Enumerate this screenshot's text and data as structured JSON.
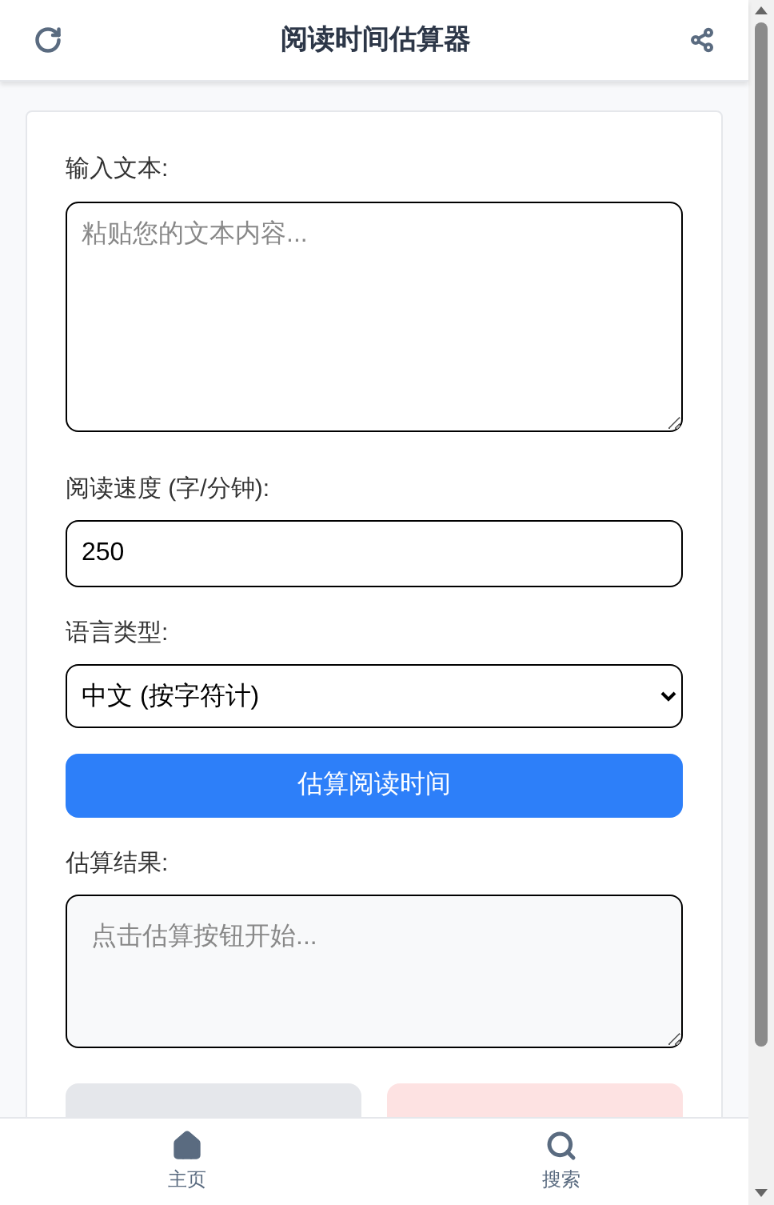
{
  "header": {
    "title": "阅读时间估算器"
  },
  "form": {
    "text_label": "输入文本:",
    "text_placeholder": "粘贴您的文本内容...",
    "speed_label": "阅读速度 (字/分钟):",
    "speed_value": "250",
    "language_label": "语言类型:",
    "language_value": "中文 (按字符计)",
    "estimate_button": "估算阅读时间",
    "result_label": "估算结果:",
    "result_placeholder": "点击估算按钮开始..."
  },
  "actions": [
    {
      "kind": "copy"
    },
    {
      "kind": "clear"
    }
  ],
  "bottom_nav": [
    {
      "kind": "home",
      "label": "主页"
    },
    {
      "kind": "search",
      "label": "搜索"
    }
  ]
}
